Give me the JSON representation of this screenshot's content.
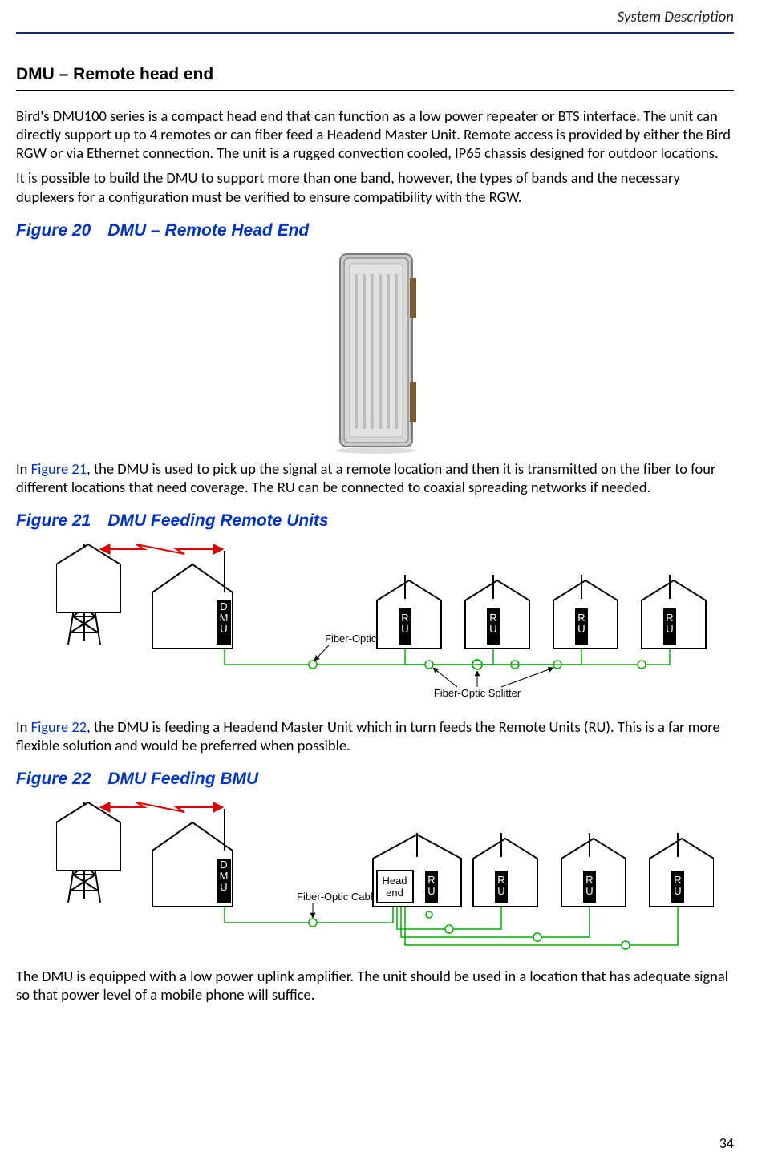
{
  "header": {
    "chapter": "System Description"
  },
  "section": {
    "title": "DMU – Remote head end"
  },
  "para1": "Bird's DMU100 series is a compact head end that can function as a low power repeater or BTS interface. The unit can directly support up to 4 remotes or can fiber feed a Headend Master Unit. Remote access is provided by either the Bird RGW or via Ethernet connection. The unit is a rugged convection cooled, IP65 chassis designed for outdoor locations.",
  "para2": "It is possible to build the DMU to support more than one band, however, the types of bands and the necessary duplexers for a configuration must be verified to ensure compatibility with the RGW.",
  "fig20": {
    "title": "Figure 20 DMU – Remote Head End"
  },
  "para3_a": "In ",
  "para3_link": "Figure 21",
  "para3_b": ", the DMU is used to pick up the signal at a remote location and then it is transmitted on the fiber to four different locations that need coverage. The RU can be connected to coaxial spreading networks if needed.",
  "fig21": {
    "title": "Figure 21 DMU Feeding Remote Units",
    "dmu": "DMU",
    "ru": "RU",
    "fiber_cable": "Fiber-Optic Cable",
    "splitter": "Fiber-Optic Splitter"
  },
  "para4_a": " In ",
  "para4_link": "Figure 22",
  "para4_b": ", the DMU is feeding a Headend Master Unit which in turn feeds the Remote Units (RU). This is a far more flexible solution and would be preferred when possible.",
  "fig22": {
    "title": "Figure 22 DMU Feeding BMU",
    "dmu": "DMU",
    "headend": "Head\nend",
    "ru": "RU",
    "fiber_cable": "Fiber-Optic Cable"
  },
  "para5": "The DMU is equipped with a low power uplink amplifier. The unit should be used in a location that has adequate signal so that power level of a mobile phone will suffice.",
  "page": "34"
}
